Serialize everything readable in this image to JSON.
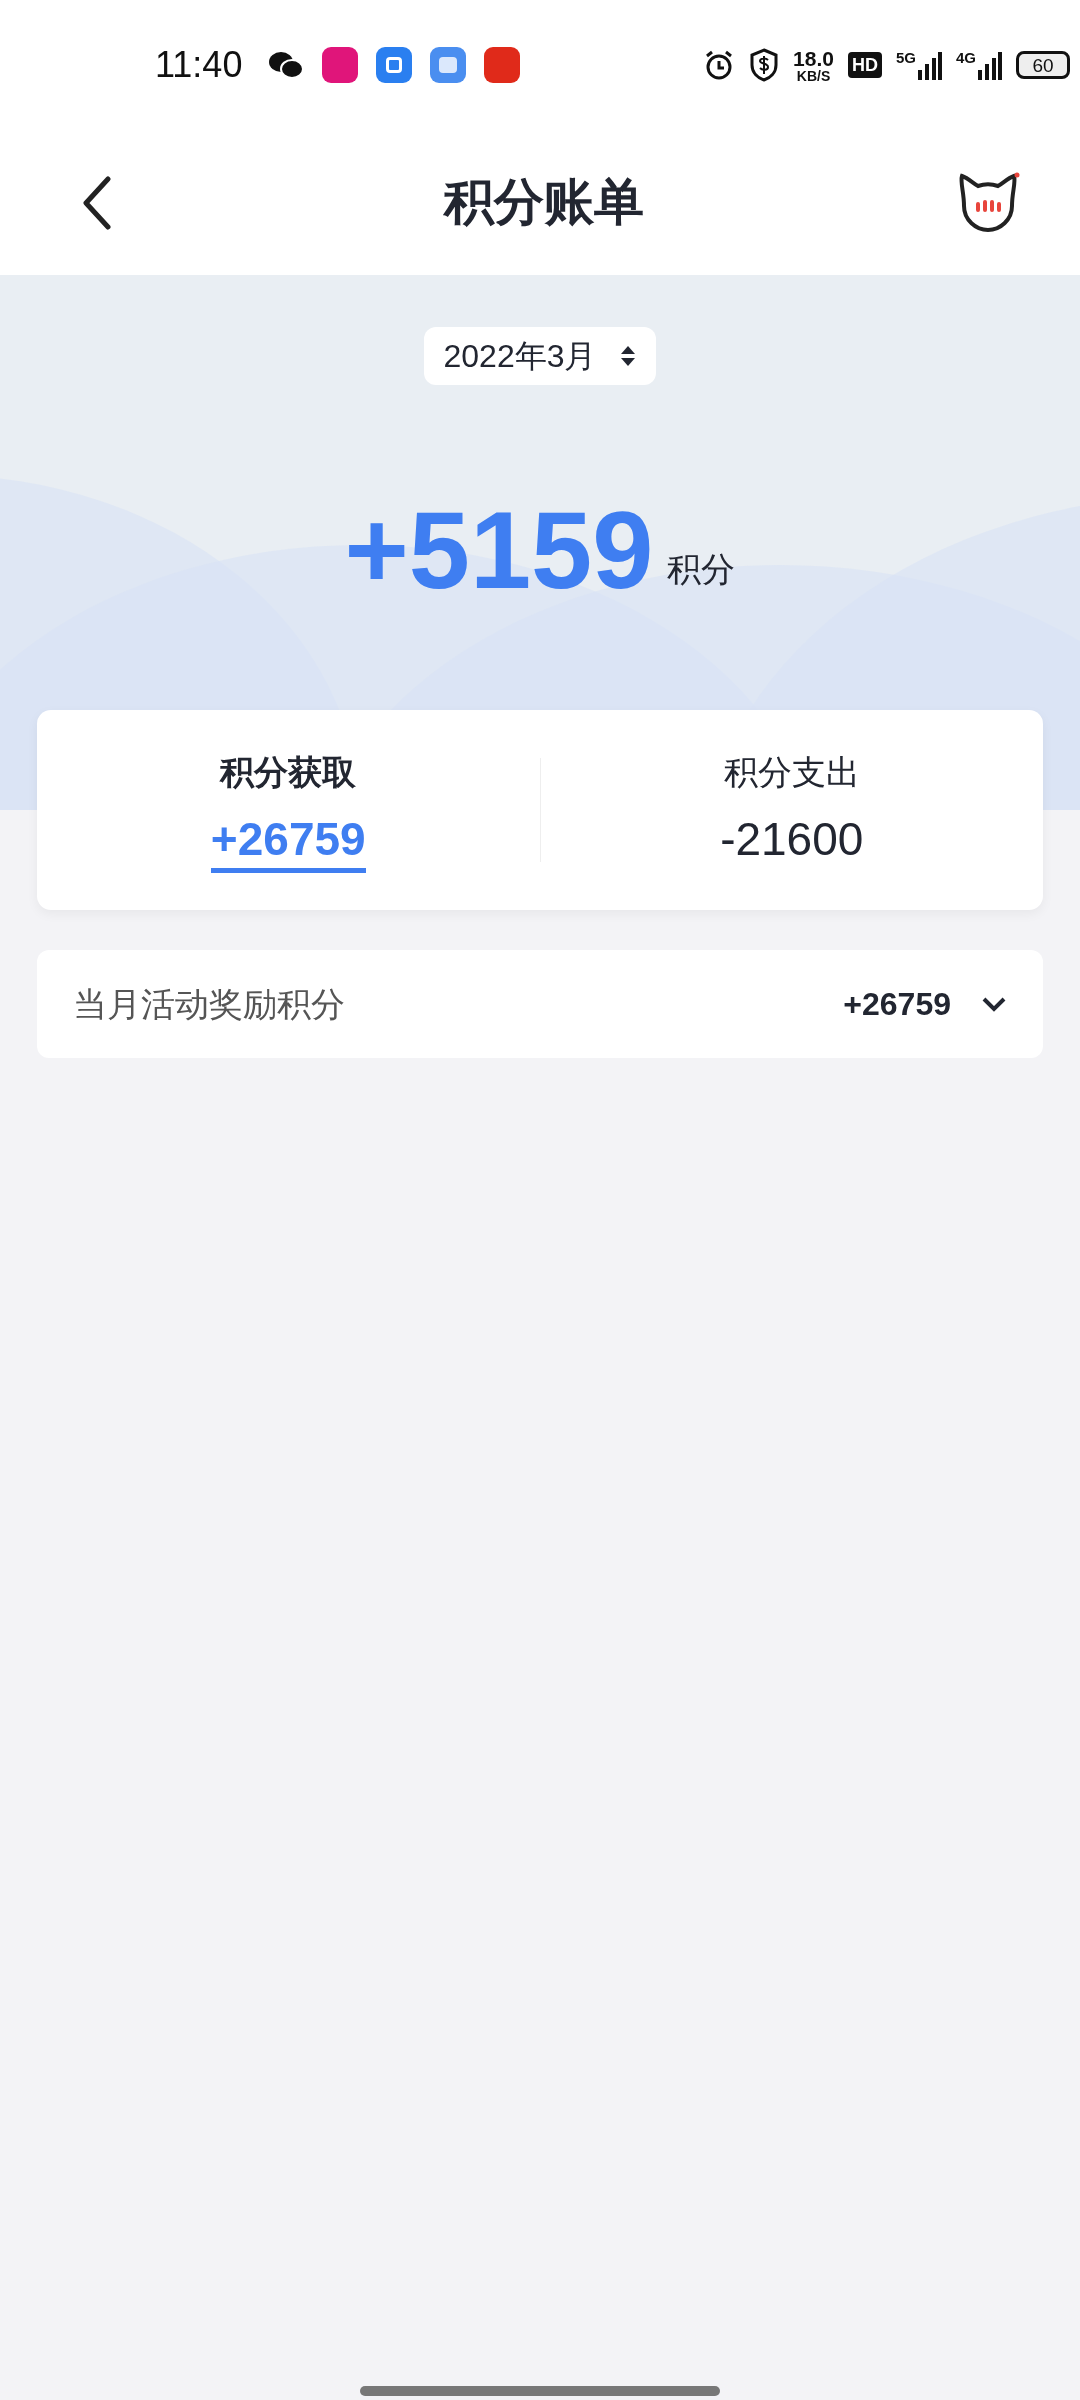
{
  "status_bar": {
    "time": "11:40",
    "net_speed": "18.0",
    "net_unit": "KB/S",
    "hd": "HD",
    "signal_1": "5G",
    "signal_2": "4G",
    "battery": "60"
  },
  "header": {
    "title": "积分账单"
  },
  "month_picker": {
    "value": "2022年3月"
  },
  "total": {
    "value": "+5159",
    "unit": "积分"
  },
  "tabs": [
    {
      "label": "积分获取",
      "value": "+26759",
      "selected": true
    },
    {
      "label": "积分支出",
      "value": "-21600",
      "selected": false
    }
  ],
  "entries": [
    {
      "label": "当月活动奖励积分",
      "value": "+26759",
      "expanded": false
    }
  ]
}
